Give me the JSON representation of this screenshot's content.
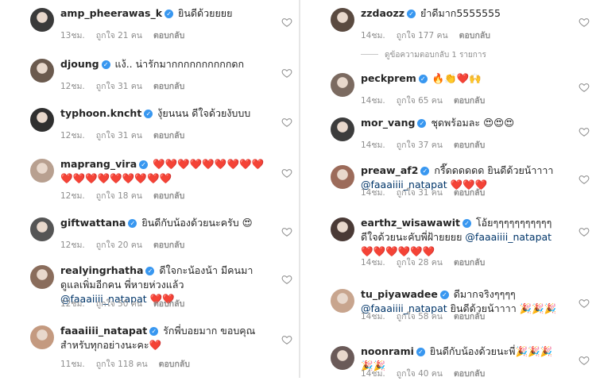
{
  "colors": {
    "mention": "#003569",
    "meta": "#8e8e8e",
    "verified": "#3897f0",
    "username": "#262626"
  },
  "labels": {
    "reply": "ตอบกลับ"
  },
  "left_comments": [
    {
      "username": "amp_pheerawas_k",
      "verified": true,
      "text": "ยินดีด้วยยยย",
      "time": "13ชม.",
      "likes": "ถูกใจ 21 คน"
    },
    {
      "username": "djoung",
      "verified": true,
      "text": "แง้.. น่ารักมากกกกกกกกกกดก",
      "time": "12ชม.",
      "likes": "ถูกใจ 31 คน"
    },
    {
      "username": "typhoon.kncht",
      "verified": true,
      "text": "งุ้ยนนน ดีใจด้วยงับบบ",
      "time": "12ชม.",
      "likes": "ถูกใจ 31 คน"
    },
    {
      "username": "maprang_vira",
      "verified": true,
      "text": "❤️❤️❤️❤️❤️❤️❤️❤️❤️❤️❤️❤️❤️❤️❤️❤️❤️❤️",
      "time": "12ชม.",
      "likes": "ถูกใจ 18 คน"
    },
    {
      "username": "giftwattana",
      "verified": true,
      "text": "ยินดีกับน้องด้วยนะครับ 😍",
      "time": "12ชม.",
      "likes": "ถูกใจ 20 คน"
    },
    {
      "username": "realyingrhatha",
      "verified": true,
      "text": "ดีใจกะน้องน้า มีคนมาดูแลเพิ่มอีกคน พี่หายห่วงแล้ว ",
      "mention": "@faaaiiii_natapat",
      "tail": " ❤️❤️",
      "time": "12ชม.",
      "likes": "ถูกใจ 50 คน"
    },
    {
      "username": "faaaiiii_natapat",
      "verified": true,
      "text": "รักพี่บอยมาก ขอบคุณสำหรับทุกอย่างนะคะ❤️",
      "time": "11ชม.",
      "likes": "ถูกใจ 118 คน"
    }
  ],
  "right_comments": [
    {
      "username": "zzdaozz",
      "verified": true,
      "text": "ยำดีมาก5555555",
      "time": "14ชม.",
      "likes": "ถูกใจ 177 คน"
    },
    {
      "username": "peckprem",
      "verified": true,
      "text": "🔥👏❤️🙌",
      "time": "14ชม.",
      "likes": "ถูกใจ 65 คน"
    },
    {
      "username": "mor_vang",
      "verified": true,
      "text": "ชุดพร้อมละ 😍😍😍",
      "time": "14ชม.",
      "likes": "ถูกใจ 37 คน"
    },
    {
      "username": "preaw_af2",
      "verified": true,
      "text": "กรี๊ดดดดดด ยินดีด้วยน้าาาา ",
      "mention": "@faaaiiii_natapat",
      "tail": " ❤️❤️❤️",
      "time": "14ชม.",
      "likes": "ถูกใจ 31 คน"
    },
    {
      "username": "earthz_wisawawit",
      "verified": true,
      "text": "โอ้ยๆๆๆๆๆๆๆๆๆๆๆ ดีใจด้วยนะคับพี่ฝ้ายยยย ",
      "mention": "@faaaiiii_natapat",
      "tail": " ❤️❤️❤️❤️❤️❤️",
      "time": "14ชม.",
      "likes": "ถูกใจ 28 คน"
    },
    {
      "username": "tu_piyawadee",
      "verified": true,
      "text": "ดีมากจริงๆๆๆๆ ",
      "mention": "@faaaiiii_natapat",
      "tail": " ยินดีด้วยน้าาาา 🎉🎉🎉",
      "time": "14ชม.",
      "likes": "ถูกใจ 58 คน"
    },
    {
      "username": "noonrami",
      "verified": true,
      "text": "ยินดีกับน้องด้วยนะพี่🎉🎉🎉🎉🎉",
      "time": "14ชม.",
      "likes": "ถูกใจ 40 คน"
    }
  ],
  "view_replies": "ดูข้อความตอบกลับ 1 รายการ"
}
